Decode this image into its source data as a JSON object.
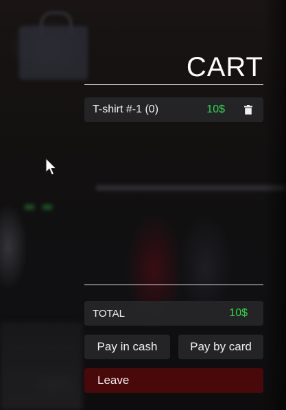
{
  "cart": {
    "title": "CART",
    "items": [
      {
        "name": "T-shirt #-1 (0)",
        "price": "10$",
        "remove_icon": "trash-icon"
      }
    ],
    "total_label": "TOTAL",
    "total_value": "10$"
  },
  "buttons": {
    "pay_cash": "Pay in cash",
    "pay_card": "Pay by card",
    "leave": "Leave"
  },
  "colors": {
    "price": "#2ed84a",
    "panel_row": "#262628",
    "leave_button": "#50080a",
    "text": "#f2f2f2"
  }
}
